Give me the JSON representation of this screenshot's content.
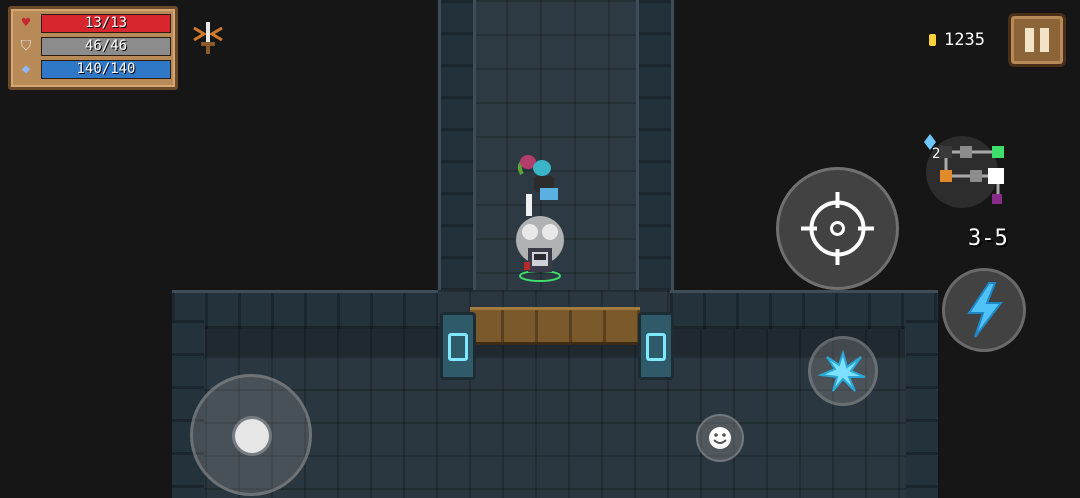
{
  "stats": {
    "health": {
      "text": "13/13",
      "current": 13,
      "max": 13,
      "color": "#d8262e"
    },
    "armor": {
      "text": "46/46",
      "current": 46,
      "max": 46,
      "color": "#8c8c8c"
    },
    "energy": {
      "text": "140/140",
      "current": 140,
      "max": 140,
      "color": "#2f78c8"
    }
  },
  "icons": {
    "health": "heart-icon",
    "armor": "shield-icon",
    "energy": "diamond-icon",
    "buff": "sword-buff-icon",
    "coin": "coin-icon",
    "pause": "pause-icon",
    "attack": "crosshair-icon",
    "skill": "lightning-icon",
    "weapon_swap": "burst-icon",
    "emote": "smile-icon"
  },
  "hud": {
    "coins": "1235",
    "level": "3-5",
    "minimap_badge": "2"
  },
  "colors": {
    "floor": "#2d3a43",
    "wall": "#22303a",
    "panel": "#b88a58",
    "coin": "#ffd23c"
  }
}
